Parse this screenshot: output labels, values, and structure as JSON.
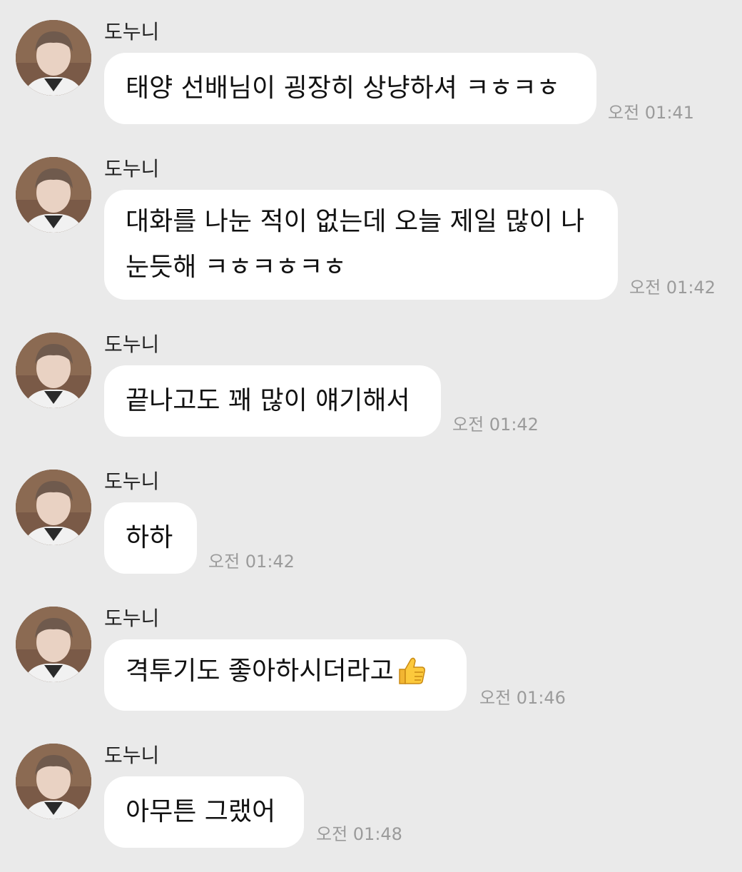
{
  "messages": [
    {
      "sender": "도누니",
      "lines": [
        "태양 선배님이 굉장히 상냥하셔 ㅋㅎㅋㅎ"
      ],
      "time": "오전 01:41"
    },
    {
      "sender": "도누니",
      "lines": [
        "대화를 나눈 적이 없는데 오늘 제일 많이 나",
        "눈듯해 ㅋㅎㅋㅎㅋㅎ"
      ],
      "time": "오전 01:42"
    },
    {
      "sender": "도누니",
      "lines": [
        "끝나고도 꽤 많이 얘기해서"
      ],
      "time": "오전 01:42"
    },
    {
      "sender": "도누니",
      "lines": [
        "하하"
      ],
      "time": "오전 01:42"
    },
    {
      "sender": "도누니",
      "lines": [
        "격투기도 좋아하시더라고"
      ],
      "emoji": "thumbs-up-icon",
      "time": "오전 01:46"
    },
    {
      "sender": "도누니",
      "lines": [
        "아무튼 그랬어"
      ],
      "time": "오전 01:48"
    }
  ]
}
